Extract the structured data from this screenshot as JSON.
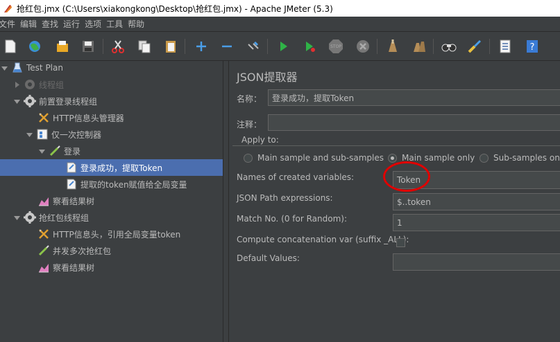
{
  "window": {
    "title": "抢红包.jmx (C:\\Users\\xiakongkong\\Desktop\\抢红包.jmx) - Apache JMeter (5.3)"
  },
  "menu": [
    "文件",
    "编辑",
    "查找",
    "运行",
    "选项",
    "工具",
    "帮助"
  ],
  "toolbar": {
    "buttons": [
      "new-icon",
      "templates-icon",
      "open-icon",
      "save-icon",
      "cut-icon",
      "copy-icon",
      "paste-icon",
      "expand-icon",
      "collapse-icon",
      "toggle-icon",
      "start-icon",
      "start-no-pause-icon",
      "stop-icon",
      "shutdown-icon",
      "clear-icon",
      "clear-all-icon",
      "search-icon",
      "reset-search-icon",
      "function-helper-icon",
      "help-icon"
    ]
  },
  "tree": {
    "nodes": [
      {
        "label": "Test Plan",
        "icon": "test-plan-icon",
        "level": 0,
        "expanded": true,
        "disabled": false
      },
      {
        "label": "线程组",
        "icon": "thread-group-icon",
        "level": 1,
        "expanded": false,
        "disabled": true
      },
      {
        "label": "前置登录线程组",
        "icon": "thread-group-icon",
        "level": 1,
        "expanded": true,
        "disabled": false
      },
      {
        "label": "HTTP信息头管理器",
        "icon": "header-manager-icon",
        "level": 2,
        "disabled": false
      },
      {
        "label": "仅一次控制器",
        "icon": "controller-icon",
        "level": 2,
        "expanded": true,
        "disabled": false
      },
      {
        "label": "登录",
        "icon": "sampler-icon",
        "level": 3,
        "expanded": true,
        "disabled": false
      },
      {
        "label": "登录成功，提取Token",
        "icon": "extractor-icon",
        "level": 4,
        "selected": true,
        "disabled": false
      },
      {
        "label": "提取的token赋值给全局变量",
        "icon": "extractor-icon",
        "level": 4,
        "disabled": false
      },
      {
        "label": "察看结果树",
        "icon": "listener-icon",
        "level": 2,
        "disabled": false
      },
      {
        "label": "抢红包线程组",
        "icon": "thread-group-icon",
        "level": 1,
        "expanded": true,
        "disabled": false
      },
      {
        "label": "HTTP信息头，引用全局变量token",
        "icon": "header-manager-icon",
        "level": 2,
        "disabled": false
      },
      {
        "label": "并发多次抢红包",
        "icon": "sampler-icon",
        "level": 2,
        "disabled": false
      },
      {
        "label": "察看结果树",
        "icon": "listener-icon",
        "level": 2,
        "disabled": false
      }
    ]
  },
  "panel": {
    "title": "JSON提取器",
    "name_label": "名称：",
    "name_value": "登录成功，提取Token",
    "comment_label": "注释：",
    "comment_value": "",
    "apply_to_label": "Apply to:",
    "radios": [
      {
        "label": "Main sample and sub-samples",
        "selected": false
      },
      {
        "label": "Main sample only",
        "selected": true
      },
      {
        "label": "Sub-samples only",
        "selected": false
      }
    ],
    "var_names_label": "Names of created variables:",
    "var_names_value": "Token",
    "json_path_label": "JSON Path expressions:",
    "json_path_value": "$..token",
    "match_no_label": "Match No. (0 for Random):",
    "match_no_value": "1",
    "concat_label": "Compute concatenation var (suffix _ALL):",
    "concat_checked": false,
    "default_label": "Default Values:",
    "default_value": ""
  },
  "colors": {
    "background": "#3c3f41",
    "selection": "#4b6eaf",
    "annotation": "#e00000"
  }
}
